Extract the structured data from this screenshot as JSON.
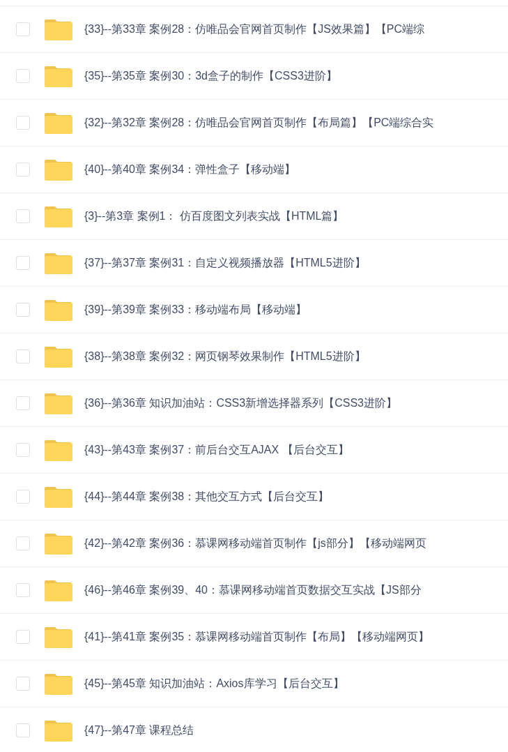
{
  "files": [
    {
      "name": "{33}--第33章 案例28：仿唯品会官网首页制作【JS效果篇】【PC端综",
      "checked": false
    },
    {
      "name": "{35}--第35章 案例30：3d盒子的制作【CSS3进阶】",
      "checked": false
    },
    {
      "name": "{32}--第32章 案例28：仿唯品会官网首页制作【布局篇】【PC端综合实",
      "checked": false
    },
    {
      "name": "{40}--第40章 案例34：弹性盒子【移动端】",
      "checked": false
    },
    {
      "name": "{3}--第3章 案例1： 仿百度图文列表实战【HTML篇】",
      "checked": false
    },
    {
      "name": "{37}--第37章 案例31：自定义视频播放器【HTML5进阶】",
      "checked": false
    },
    {
      "name": "{39}--第39章 案例33：移动端布局【移动端】",
      "checked": false
    },
    {
      "name": "{38}--第38章 案例32：网页钢琴效果制作【HTML5进阶】",
      "checked": false
    },
    {
      "name": "{36}--第36章 知识加油站：CSS3新增选择器系列【CSS3进阶】",
      "checked": false
    },
    {
      "name": "{43}--第43章 案例37：前后台交互AJAX 【后台交互】",
      "checked": false
    },
    {
      "name": "{44}--第44章 案例38：其他交互方式【后台交互】",
      "checked": false
    },
    {
      "name": "{42}--第42章 案例36：慕课网移动端首页制作【js部分】【移动端网页",
      "checked": false
    },
    {
      "name": "{46}--第46章 案例39、40：慕课网移动端首页数据交互实战【JS部分",
      "checked": false
    },
    {
      "name": "{41}--第41章 案例35：慕课网移动端首页制作【布局】【移动端网页】",
      "checked": false
    },
    {
      "name": "{45}--第45章 知识加油站：Axios库学习【后台交互】",
      "checked": false
    },
    {
      "name": "{47}--第47章 课程总结",
      "checked": false
    }
  ]
}
